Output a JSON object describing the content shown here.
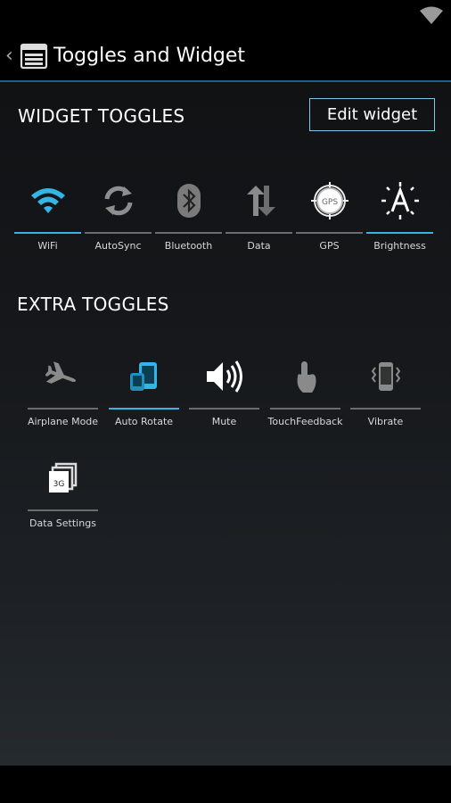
{
  "app": {
    "title": "Toggles and Widget",
    "accent": "#33b5e5"
  },
  "widget_section": {
    "title": "WIDGET TOGGLES",
    "edit_button": "Edit widget",
    "toggles": [
      {
        "label": "WiFi",
        "icon": "wifi-icon",
        "on": true
      },
      {
        "label": "AutoSync",
        "icon": "sync-icon",
        "on": false
      },
      {
        "label": "Bluetooth",
        "icon": "bluetooth-icon",
        "on": false
      },
      {
        "label": "Data",
        "icon": "data-arrows-icon",
        "on": false
      },
      {
        "label": "GPS",
        "icon": "gps-icon",
        "on": false
      },
      {
        "label": "Brightness",
        "icon": "brightness-icon",
        "on": true
      }
    ]
  },
  "extra_section": {
    "title": "EXTRA TOGGLES",
    "toggles": [
      {
        "label": "Airplane Mode",
        "icon": "airplane-icon",
        "on": false
      },
      {
        "label": "Auto Rotate",
        "icon": "auto-rotate-icon",
        "on": true
      },
      {
        "label": "Mute",
        "icon": "speaker-icon",
        "on": false
      },
      {
        "label": "TouchFeedback",
        "icon": "touch-icon",
        "on": false
      },
      {
        "label": "Vibrate",
        "icon": "vibrate-icon",
        "on": false
      },
      {
        "label": "Data Settings",
        "icon": "data-settings-icon",
        "on": false
      }
    ]
  },
  "icon_texts": {
    "gps": "GPS",
    "three_g": "3G"
  }
}
